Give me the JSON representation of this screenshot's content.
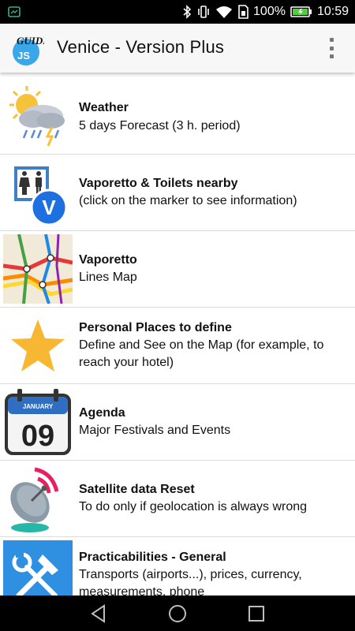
{
  "status_bar": {
    "battery_percent": "100%",
    "time": "10:59"
  },
  "app_bar": {
    "logo_text_top": "GUIDE",
    "logo_text_bottom": "JS",
    "title": "Venice - Version Plus"
  },
  "items": [
    {
      "title": "Weather",
      "subtitle": "5 days Forecast (3 h. period)",
      "icon": "weather-icon"
    },
    {
      "title": "Vaporetto & Toilets nearby",
      "subtitle": "(click on the marker to see information)",
      "icon": "toilets-vaporetto-icon",
      "badge": "V"
    },
    {
      "title": "Vaporetto",
      "subtitle": "Lines Map",
      "icon": "lines-map-icon"
    },
    {
      "title": "Personal Places to define",
      "subtitle": "Define and See on the Map (for example, to reach your hotel)",
      "icon": "star-icon"
    },
    {
      "title": "Agenda",
      "subtitle": "Major Festivals and Events",
      "icon": "calendar-icon",
      "month": "JANUARY",
      "day": "09"
    },
    {
      "title": "Satellite data Reset",
      "subtitle": "To do only if geolocation is always wrong",
      "icon": "satellite-dish-icon"
    },
    {
      "title": "Practicabilities - General",
      "subtitle": "Transports (airports...), prices, currency, measurements, phone",
      "icon": "tools-icon"
    }
  ],
  "colors": {
    "status_bar": "#000000",
    "app_bar": "#f7f7f7",
    "logo_blue": "#3aa7e8",
    "badge_blue": "#1e6fe0",
    "star_yellow": "#f7b733",
    "tools_blue": "#2f8fe0"
  }
}
